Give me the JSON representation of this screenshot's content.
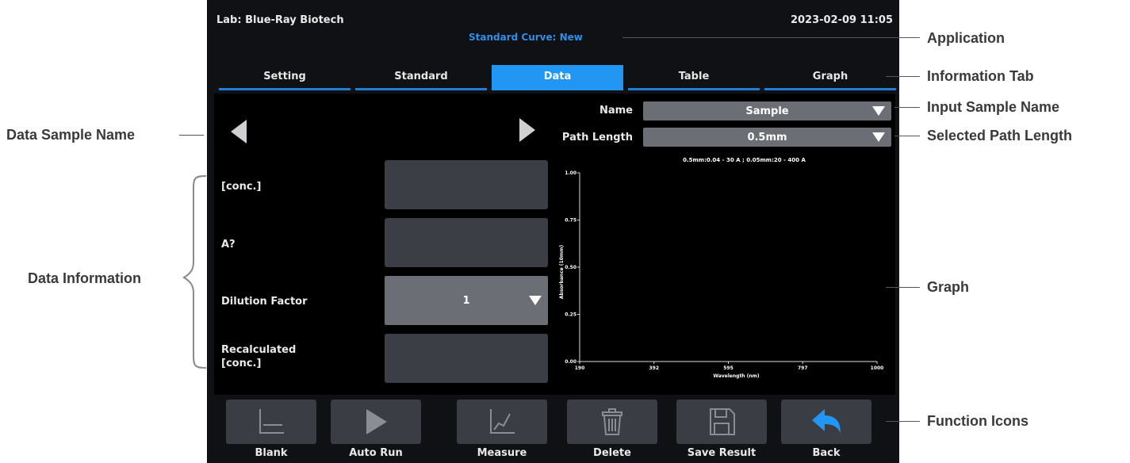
{
  "header": {
    "lab": "Lab: Blue-Ray Biotech",
    "datetime": "2023-02-09 11:05",
    "application": "Standard Curve: New"
  },
  "tabs": [
    {
      "label": "Setting",
      "active": false
    },
    {
      "label": "Standard",
      "active": false
    },
    {
      "label": "Data",
      "active": true
    },
    {
      "label": "Table",
      "active": false
    },
    {
      "label": "Graph",
      "active": false
    }
  ],
  "sample": {
    "name_label": "Name",
    "name_value": "Sample",
    "path_label": "Path Length",
    "path_value": "0.5mm"
  },
  "fields": {
    "conc": {
      "label": "[conc.]",
      "value": ""
    },
    "a": {
      "label": "A?",
      "value": ""
    },
    "dilution": {
      "label": "Dilution Factor",
      "value": "1"
    },
    "recalc": {
      "label": "Recalculated [conc.]",
      "value": ""
    }
  },
  "chart_data": {
    "type": "line",
    "subtitle": "0.5mm:0.04 - 30 A ; 0.05mm:20 - 400 A",
    "xlabel": "Wavelength (nm)",
    "ylabel": "Absorbance (10mm)",
    "x_ticks": [
      "190",
      "392",
      "595",
      "797",
      "1000"
    ],
    "y_ticks": [
      "0.00",
      "0.25",
      "0.50",
      "0.75",
      "1.00"
    ],
    "xlim": [
      190,
      1000
    ],
    "ylim": [
      0,
      1
    ],
    "series": []
  },
  "toolbar": [
    {
      "label": "Blank",
      "icon": "blank-icon",
      "enabled": false
    },
    {
      "label": "Auto Run",
      "icon": "play-icon",
      "enabled": false
    },
    {
      "label": "Measure",
      "icon": "measure-icon",
      "enabled": false
    },
    {
      "label": "Delete",
      "icon": "trash-icon",
      "enabled": false
    },
    {
      "label": "Save Result",
      "icon": "save-icon",
      "enabled": false
    },
    {
      "label": "Back",
      "icon": "back-arrow-icon",
      "enabled": true
    }
  ],
  "callouts": {
    "application": "Application",
    "information_tab": "Information Tab",
    "input_sample_name": "Input Sample Name",
    "selected_path_length": "Selected Path Length",
    "graph": "Graph",
    "function_icons": "Function Icons",
    "data_sample_name": "Data Sample Name",
    "data_information": "Data Information"
  },
  "colors": {
    "accent": "#2196f3",
    "app_text": "#2f8fe6",
    "background": "#101114"
  }
}
